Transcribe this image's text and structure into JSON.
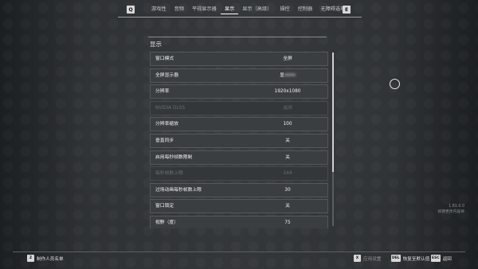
{
  "nav": {
    "prev_key": "Q",
    "next_key": "E",
    "tabs": [
      {
        "label": "游戏性"
      },
      {
        "label": "音频"
      },
      {
        "label": "平视显示器"
      },
      {
        "label": "显示"
      },
      {
        "label": "显示（高级）"
      },
      {
        "label": "操控"
      },
      {
        "label": "控制器"
      },
      {
        "label": "无障碍选项"
      }
    ],
    "active_tab": "显示"
  },
  "panel": {
    "title": "显示",
    "rows": [
      {
        "label": "窗口模式",
        "value": "全屏",
        "disabled": false
      },
      {
        "label": "全屏显示器",
        "value": "显",
        "disabled": false,
        "blurred": true
      },
      {
        "label": "分辨率",
        "value": "1920x1080",
        "disabled": false
      },
      {
        "label": "NVIDIA DLSS",
        "value": "关闭",
        "disabled": true
      },
      {
        "label": "分辨率缩放",
        "value": "100",
        "disabled": false
      },
      {
        "label": "垂直同步",
        "value": "关",
        "disabled": false
      },
      {
        "label": "启用每秒帧数限制",
        "value": "关",
        "disabled": false
      },
      {
        "label": "每秒帧数上限",
        "value": "144",
        "disabled": true
      },
      {
        "label": "过场动画每秒帧数上限",
        "value": "30",
        "disabled": false
      },
      {
        "label": "窗口锁定",
        "value": "关",
        "disabled": false
      },
      {
        "label": "视野（度）",
        "value": "75",
        "disabled": false
      }
    ]
  },
  "hint": {
    "line1": "1.81.0.0",
    "line2": "按键更改内容将"
  },
  "bottom": {
    "credits_key": "Z",
    "credits_label": "制作人员名单",
    "apply_key": "X",
    "apply_label": "应用设置",
    "reset_key": "DEL",
    "reset_label": "恢复至默认值",
    "back_key": "ESC",
    "back_label": "返回"
  }
}
